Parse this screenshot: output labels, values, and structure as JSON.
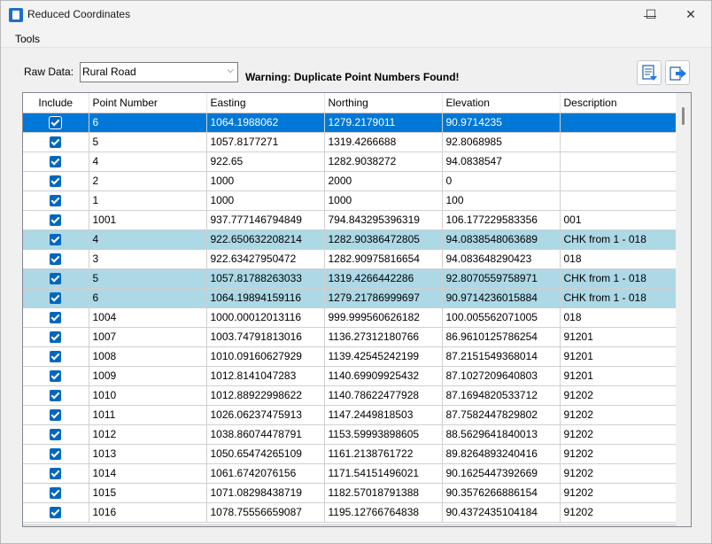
{
  "window": {
    "title": "Reduced Coordinates",
    "minimize_glyph": "—",
    "maximize_glyph": "☐",
    "close_glyph": "✕"
  },
  "menu": {
    "items": [
      {
        "label": "Tools"
      }
    ]
  },
  "toolbar": {
    "raw_data_label": "Raw Data:",
    "raw_data_value": "Rural Road",
    "warning": "Warning: Duplicate Point Numbers Found!",
    "buttons": [
      "report-icon",
      "export-icon"
    ]
  },
  "grid": {
    "columns": [
      "Include",
      "Point Number",
      "Easting",
      "Northing",
      "Elevation",
      "Description"
    ],
    "rows": [
      {
        "state": "selected",
        "include": true,
        "point": "6",
        "easting": "1064.1988062",
        "northing": "1279.2179011",
        "elevation": "90.9714235",
        "description": ""
      },
      {
        "state": "normal",
        "include": true,
        "point": "5",
        "easting": "1057.8177271",
        "northing": "1319.4266688",
        "elevation": "92.8068985",
        "description": ""
      },
      {
        "state": "normal",
        "include": true,
        "point": "4",
        "easting": "922.65",
        "northing": "1282.9038272",
        "elevation": "94.0838547",
        "description": ""
      },
      {
        "state": "normal",
        "include": true,
        "point": "2",
        "easting": "1000",
        "northing": "2000",
        "elevation": "0",
        "description": ""
      },
      {
        "state": "normal",
        "include": true,
        "point": "1",
        "easting": "1000",
        "northing": "1000",
        "elevation": "100",
        "description": ""
      },
      {
        "state": "normal",
        "include": true,
        "point": "1001",
        "easting": "937.777146794849",
        "northing": "794.843295396319",
        "elevation": "106.177229583356",
        "description": "001"
      },
      {
        "state": "dup",
        "include": true,
        "point": "4",
        "easting": "922.650632208214",
        "northing": "1282.90386472805",
        "elevation": "94.0838548063689",
        "description": "CHK from 1 - 018"
      },
      {
        "state": "normal",
        "include": true,
        "point": "3",
        "easting": "922.63427950472",
        "northing": "1282.90975816654",
        "elevation": "94.083648290423",
        "description": "018"
      },
      {
        "state": "dup",
        "include": true,
        "point": "5",
        "easting": "1057.81788263033",
        "northing": "1319.4266442286",
        "elevation": "92.8070559758971",
        "description": "CHK from 1 - 018"
      },
      {
        "state": "dup",
        "include": true,
        "point": "6",
        "easting": "1064.19894159116",
        "northing": "1279.21786999697",
        "elevation": "90.9714236015884",
        "description": "CHK from 1 - 018"
      },
      {
        "state": "normal",
        "include": true,
        "point": "1004",
        "easting": "1000.00012013116",
        "northing": "999.999560626182",
        "elevation": "100.005562071005",
        "description": "018"
      },
      {
        "state": "normal",
        "include": true,
        "point": "1007",
        "easting": "1003.74791813016",
        "northing": "1136.27312180766",
        "elevation": "86.9610125786254",
        "description": "91201"
      },
      {
        "state": "normal",
        "include": true,
        "point": "1008",
        "easting": "1010.09160627929",
        "northing": "1139.42545242199",
        "elevation": "87.2151549368014",
        "description": "91201"
      },
      {
        "state": "normal",
        "include": true,
        "point": "1009",
        "easting": "1012.8141047283",
        "northing": "1140.69909925432",
        "elevation": "87.1027209640803",
        "description": "91201"
      },
      {
        "state": "normal",
        "include": true,
        "point": "1010",
        "easting": "1012.88922998622",
        "northing": "1140.78622477928",
        "elevation": "87.1694820533712",
        "description": "91202"
      },
      {
        "state": "normal",
        "include": true,
        "point": "1011",
        "easting": "1026.06237475913",
        "northing": "1147.2449818503",
        "elevation": "87.7582447829802",
        "description": "91202"
      },
      {
        "state": "normal",
        "include": true,
        "point": "1012",
        "easting": "1038.86074478791",
        "northing": "1153.59993898605",
        "elevation": "88.5629641840013",
        "description": "91202"
      },
      {
        "state": "normal",
        "include": true,
        "point": "1013",
        "easting": "1050.65474265109",
        "northing": "1161.2138761722",
        "elevation": "89.8264893240416",
        "description": "91202"
      },
      {
        "state": "normal",
        "include": true,
        "point": "1014",
        "easting": "1061.6742076156",
        "northing": "1171.54151496021",
        "elevation": "90.1625447392669",
        "description": "91202"
      },
      {
        "state": "normal",
        "include": true,
        "point": "1015",
        "easting": "1071.08298438719",
        "northing": "1182.57018791388",
        "elevation": "90.3576266886154",
        "description": "91202"
      },
      {
        "state": "normal",
        "include": true,
        "point": "1016",
        "easting": "1078.75556659087",
        "northing": "1195.12766764838",
        "elevation": "90.4372435104184",
        "description": "91202"
      }
    ]
  },
  "colors": {
    "selected_row": "#0078d7",
    "duplicate_row": "#add8e6",
    "checkbox": "#0067c0"
  }
}
